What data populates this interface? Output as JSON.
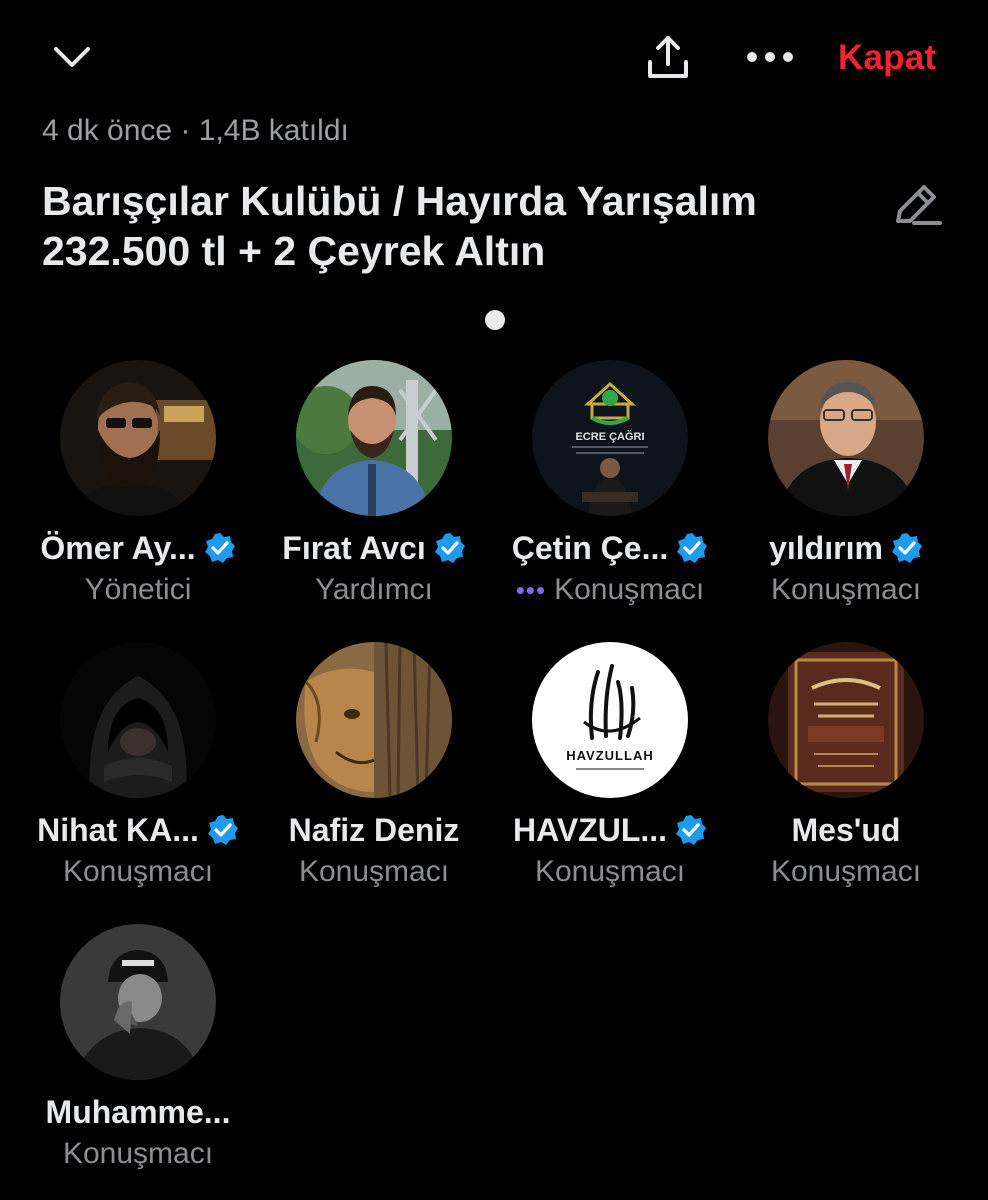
{
  "header": {
    "close_label": "Kapat",
    "meta": "4 dk önce · 1,4B katıldı",
    "title_line1": "Barışçılar Kulübü / Hayırda Yarışalım",
    "title_line2": "232.500 tl + 2 Çeyrek Altın"
  },
  "colors": {
    "accent_red": "#f4212e",
    "verified_blue": "#1d9bf0",
    "speaking_purple": "#7b6cf2"
  },
  "participants": [
    {
      "name": "Ömer Ay...",
      "role": "Yönetici",
      "verified": true
    },
    {
      "name": "Fırat Avcı",
      "role": "Yardımcı",
      "verified": true
    },
    {
      "name": "Çetin Çe...",
      "role": "Konuşmacı",
      "verified": true,
      "speaking": true
    },
    {
      "name": "yıldırım",
      "role": "Konuşmacı",
      "verified": true
    },
    {
      "name": "Nihat KA...",
      "role": "Konuşmacı",
      "verified": true
    },
    {
      "name": "Nafiz Deniz",
      "role": "Konuşmacı",
      "verified": false
    },
    {
      "name": "HAVZUL...",
      "role": "Konuşmacı",
      "verified": true
    },
    {
      "name": "Mes'ud",
      "role": "Konuşmacı",
      "verified": false
    },
    {
      "name": "Muhamme...",
      "role": "Konuşmacı",
      "verified": false
    }
  ],
  "avatar_text": {
    "ecre_title": "ECRE ÇAĞRI",
    "havzullah": "HAVZULLAH"
  },
  "icons": {
    "collapse": "chevron-down-icon",
    "share": "share-icon",
    "more": "more-icon",
    "edit": "edit-icon",
    "verified": "verified-badge-icon"
  }
}
